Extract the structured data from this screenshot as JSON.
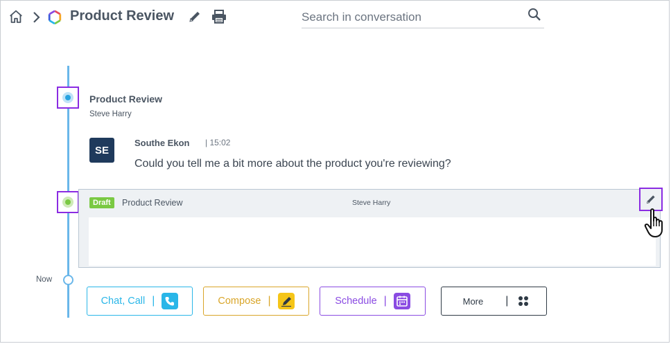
{
  "header": {
    "title": "Product Review",
    "search_placeholder": "Search in conversation"
  },
  "timeline": {
    "entry": {
      "title": "Product Review",
      "author": "Steve Harry"
    },
    "message": {
      "avatar_initials": "SE",
      "author": "Southe Ekon",
      "time": "| 15:02",
      "text": "Could you tell me a bit more about the product you're reviewing?"
    },
    "draft": {
      "badge": "Draft",
      "title": "Product Review",
      "author": "Steve Harry"
    },
    "now_label": "Now"
  },
  "actions": {
    "chat_call": {
      "label": "Chat, Call",
      "sep": "|",
      "color": "#29b6e8"
    },
    "compose": {
      "label": "Compose",
      "sep": "|",
      "color": "#d9a528"
    },
    "schedule": {
      "label": "Schedule",
      "sep": "|",
      "color": "#8a4be2"
    },
    "more": {
      "label": "More",
      "sep": "|",
      "color": "#2f3a45"
    }
  },
  "colors": {
    "timeline": "#6ab7ea",
    "highlight": "#8a2be2",
    "draft_green": "#7ac943",
    "avatar_bg": "#1f3a5c"
  },
  "icons": [
    "home-icon",
    "chevron-right-icon",
    "hexagon-logo-icon",
    "pencil-icon",
    "printer-icon",
    "search-icon",
    "phone-icon",
    "compose-icon",
    "calendar-icon",
    "grid-icon",
    "hand-cursor-icon"
  ]
}
